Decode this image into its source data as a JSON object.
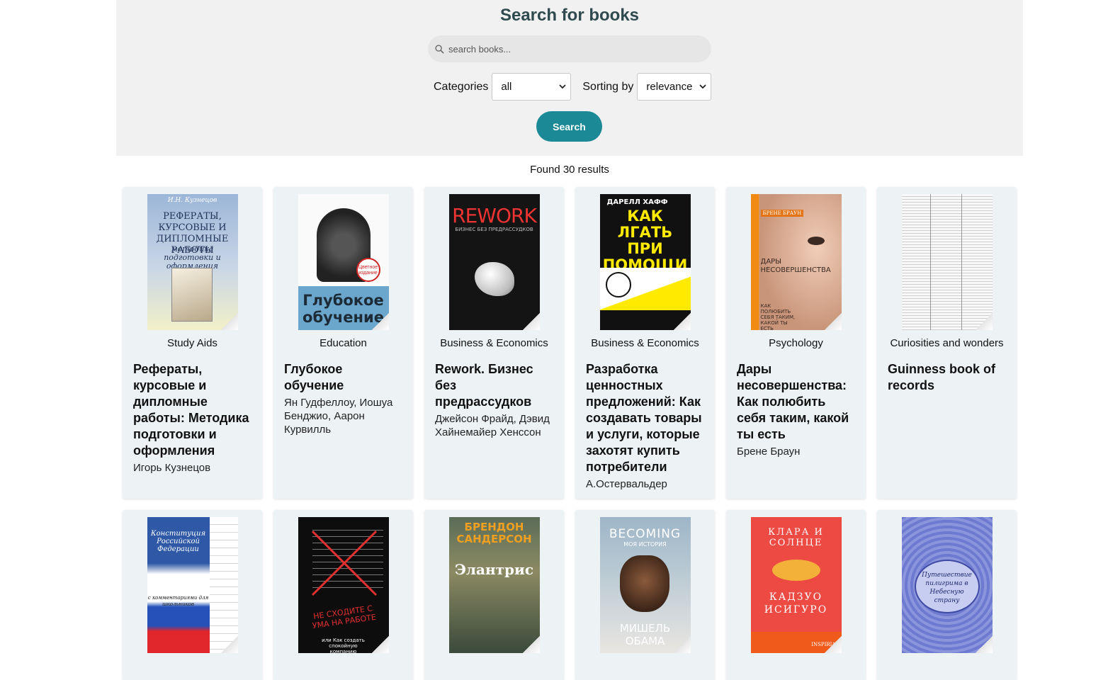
{
  "header": {
    "title": "Search for books",
    "search_placeholder": "search books...",
    "categories_label": "Categories",
    "categories_value": "all",
    "sorting_label": "Sorting by",
    "sorting_value": "relevance",
    "search_button": "Search"
  },
  "results": {
    "text": "Found 30 results"
  },
  "books_row1": [
    {
      "category": "Study Aids",
      "title": "Рефераты, курсовые и дипломные работы: Методика подготовки и оформления",
      "author": "Игорь Кузнецов"
    },
    {
      "category": "Education",
      "title": "Глубокое обучение",
      "author": "Ян Гудфеллоу, Иошуа Бенджио, Аарон Курвилль"
    },
    {
      "category": "Business & Economics",
      "title": "Rework. Бизнес без предрассудков",
      "author": "Джейсон Фрайд, Дэвид Хайнемайер Хенссон"
    },
    {
      "category": "Business & Economics",
      "title": "Разработка ценностных предложений: Как создавать товары и услуги, которые захотят купить потребители",
      "author": "А.Остервальдер"
    },
    {
      "category": "Psychology",
      "title": "Дары несовершенства: Как полюбить себя таким, какой ты есть",
      "author": "Брене Браун"
    },
    {
      "category": "Curiosities and wonders",
      "title": "Guinness book of records",
      "author": ""
    }
  ],
  "covers": {
    "c1": {
      "top": "И.Н. Кузнецов",
      "main": "РЕФЕРАТЫ, КУРСОВЫЕ И ДИПЛОМНЫЕ РАБОТЫ",
      "sub": "методика подготовки и оформления"
    },
    "c2": {
      "main": "Глубокое обучение",
      "badge": "Цветное издание"
    },
    "c3": {
      "main": "REWORK",
      "sub": "БИЗНЕС БЕЗ ПРЕДРАССУДКОВ"
    },
    "c4": {
      "top": "ДАРЕЛЛ ХАФФ",
      "main": "КАК ЛГАТЬ ПРИ ПОМОЩИ СТАТИСТИКИ"
    },
    "c5": {
      "top": "БРЕНЕ БРАУН",
      "main": "ДАРЫ НЕСОВЕРШЕНСТВА",
      "sub": "КАК ПОЛЮБИТЬ СЕБЯ ТАКИМ, КАКОЙ ТЫ ЕСТЬ"
    },
    "c7": {
      "main": "Конституция Российской Федерации",
      "sub": "с комментариями для школьников"
    },
    "c8": {
      "main": "НЕ СХОДИТЕ С УМА НА РАБОТЕ",
      "sub": "или Как создать спокойную компанию"
    },
    "c9": {
      "top": "БРЕНДОН САНДЕРСОН",
      "main": "Элантрис"
    },
    "c10": {
      "top": "BECOMING",
      "sub": "МОЯ ИСТОРИЯ",
      "main": "МИШЕЛЬ ОБАМА"
    },
    "c11": {
      "top": "КЛАРА И СОЛНЦЕ",
      "main": "КАДЗУО ИСИГУРО",
      "badge": "INSPIRIA"
    },
    "c12": {
      "main": "Путешествие пилигрима в Небесную страну"
    }
  },
  "colors": {
    "accent": "#1c8a96",
    "title": "#2f4a4e",
    "card_bg": "#edf3f5",
    "header_bg": "#f1f1f1"
  },
  "icons": {
    "search": "search-icon",
    "dropdown": "chevron-down-icon"
  }
}
